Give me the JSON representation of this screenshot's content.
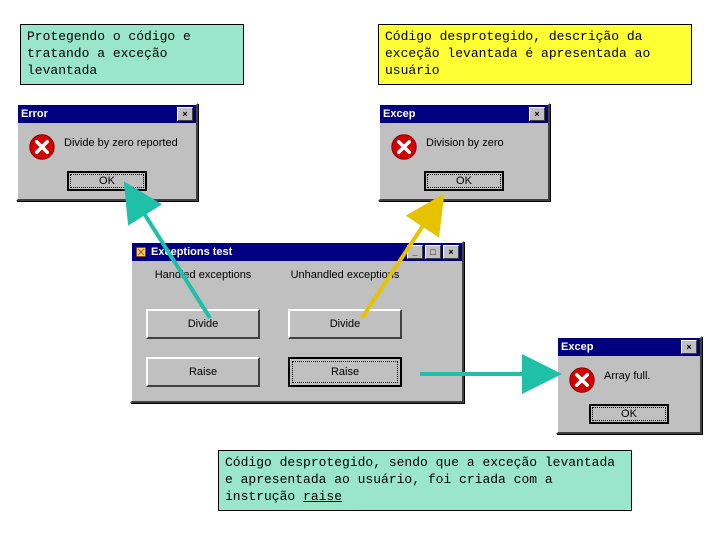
{
  "notes": {
    "top_left": "Protegendo o código e tratando a exceção levantada",
    "top_right": "Código desprotegido, descrição da exceção levantada é apresentada ao usuário",
    "bottom": "Código desprotegido, sendo que a exceção levantada e apresentada ao usuário, foi criada com a instrução ",
    "bottom_kw": "raise"
  },
  "dialog_error": {
    "title": "Error",
    "message": "Divide by zero reported",
    "ok": "OK"
  },
  "dialog_excep1": {
    "title": "Excep",
    "message": "Division by zero",
    "ok": "OK"
  },
  "dialog_excep2": {
    "title": "Excep",
    "message": "Array full.",
    "ok": "OK"
  },
  "main_win": {
    "title": "Exceptions test",
    "col_handled": "Handled exceptions",
    "col_unhandled": "Unhandled exceptions",
    "btn_divide": "Divide",
    "btn_raise": "Raise"
  },
  "colors": {
    "arrow_teal": "#1fbfa8",
    "arrow_yellow": "#ffd400"
  }
}
